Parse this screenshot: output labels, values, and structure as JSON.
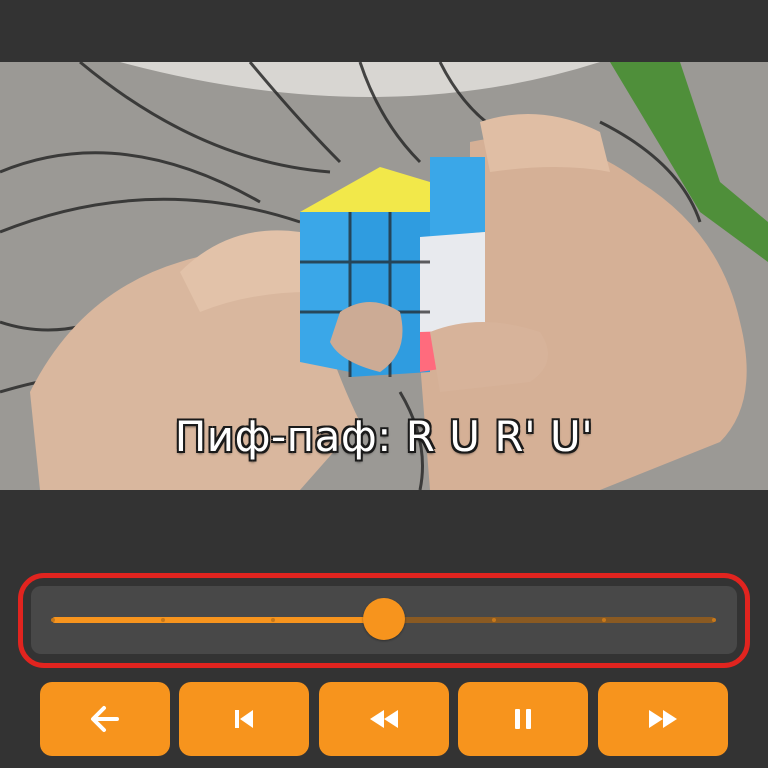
{
  "video": {
    "subtitle": "Пиф-паф: R U R' U'"
  },
  "timeline": {
    "progress": 0.5,
    "step_count": 7,
    "current_step": 4
  },
  "controls": [
    {
      "id": "back",
      "icon": "arrow-left-icon"
    },
    {
      "id": "previous",
      "icon": "skip-previous-icon"
    },
    {
      "id": "rewind",
      "icon": "rewind-icon"
    },
    {
      "id": "pause",
      "icon": "pause-icon"
    },
    {
      "id": "fast-forward",
      "icon": "fast-forward-icon"
    }
  ],
  "colors": {
    "accent": "#f7941d",
    "highlight_border": "#e1241f",
    "background": "#333333",
    "panel": "#484848",
    "icon": "#ffffff"
  }
}
